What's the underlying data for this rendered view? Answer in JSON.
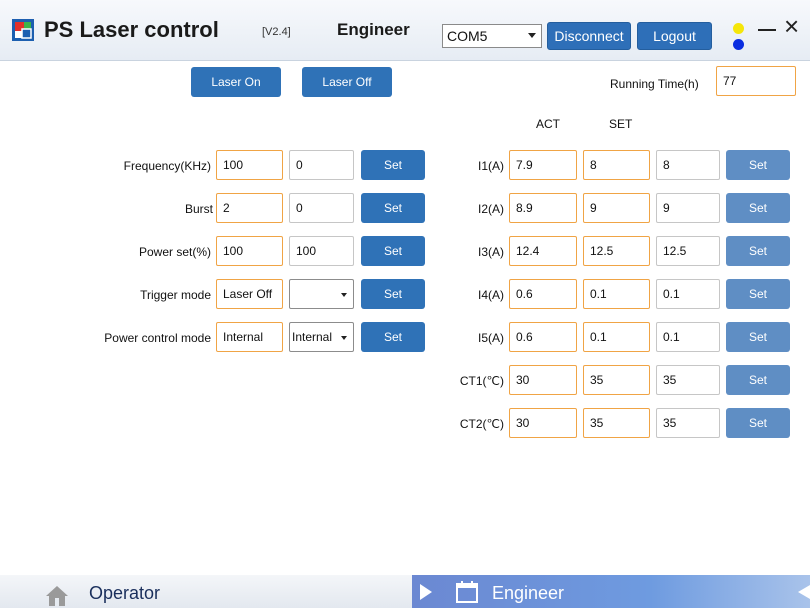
{
  "header": {
    "title": "PS Laser control",
    "version": "[V2.4]",
    "role": "Engineer",
    "com_port": "COM5",
    "disconnect_label": "Disconnect",
    "logout_label": "Logout",
    "close_glyph": "×"
  },
  "laser": {
    "on_label": "Laser On",
    "off_label": "Laser Off",
    "running_time_label": "Running Time(h)",
    "running_time_value": "77"
  },
  "left": {
    "set_label": "Set",
    "rows": [
      {
        "label": "Frequency(KHz)",
        "value": "100",
        "set": "0"
      },
      {
        "label": "Burst",
        "value": "2",
        "set": "0"
      },
      {
        "label": "Power set(%)",
        "value": "100",
        "set": "100"
      },
      {
        "label": "Trigger mode",
        "value": "Laser Off",
        "set": ""
      },
      {
        "label": "Power  control mode",
        "value": "Internal",
        "set": "Internal"
      }
    ]
  },
  "right": {
    "act_header": "ACT",
    "set_header": "SET",
    "set_label": "Set",
    "rows": [
      {
        "label": "I1(A)",
        "act": "7.9",
        "set": "8",
        "input": "8"
      },
      {
        "label": "I2(A)",
        "act": "8.9",
        "set": "9",
        "input": "9"
      },
      {
        "label": "I3(A)",
        "act": "12.4",
        "set": "12.5",
        "input": "12.5"
      },
      {
        "label": "I4(A)",
        "act": "0.6",
        "set": "0.1",
        "input": "0.1"
      },
      {
        "label": "I5(A)",
        "act": "0.6",
        "set": "0.1",
        "input": "0.1"
      },
      {
        "label": "CT1(℃)",
        "act": "30",
        "set": "35",
        "input": "35"
      },
      {
        "label": "CT2(℃)",
        "act": "30",
        "set": "35",
        "input": "35"
      }
    ]
  },
  "nav": {
    "operator_label": "Operator",
    "engineer_label": "Engineer",
    "active": "Engineer"
  },
  "colors": {
    "accent": "#2f72b7",
    "field_border": "#f0a445",
    "indicator_top": "#f5e60a",
    "indicator_bottom": "#0a2de0"
  }
}
